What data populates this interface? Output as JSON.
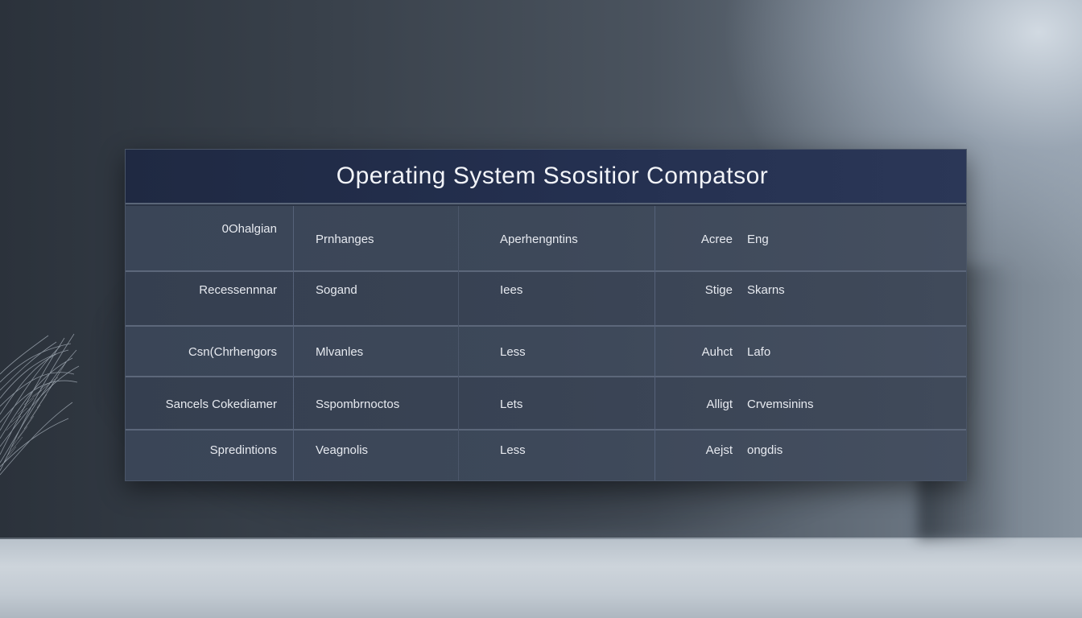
{
  "panel": {
    "title": "Operating System Ssositior Compatsor"
  },
  "table": {
    "rows": [
      {
        "label": "0Ohalgian",
        "col1": "Prnhanges",
        "col2": "Aperhengntins",
        "col3a": "Acree",
        "col3b": "Eng"
      },
      {
        "label": "Recessennnar",
        "col1": "Sogand",
        "col2": "Iees",
        "col3a": "Stige",
        "col3b": "Skarns"
      },
      {
        "label": "Csn(Chrhengors",
        "col1": "Mlvanles",
        "col2": "Less",
        "col3a": "Auhct",
        "col3b": "Lafo"
      },
      {
        "label": "Sancels Cokediamer",
        "col1": "Sspombrnoctos",
        "col2": "Lets",
        "col3a": "Alligt",
        "col3b": "Crvemsinins"
      },
      {
        "label": "Spredintions",
        "col1": "Veagnolis",
        "col2": "Less",
        "col3a": "Aejst",
        "col3b": "ongdis"
      }
    ]
  },
  "colors": {
    "title_bar": "#243050",
    "row_bg": "#3a4557",
    "text": "#e7eaf0"
  }
}
